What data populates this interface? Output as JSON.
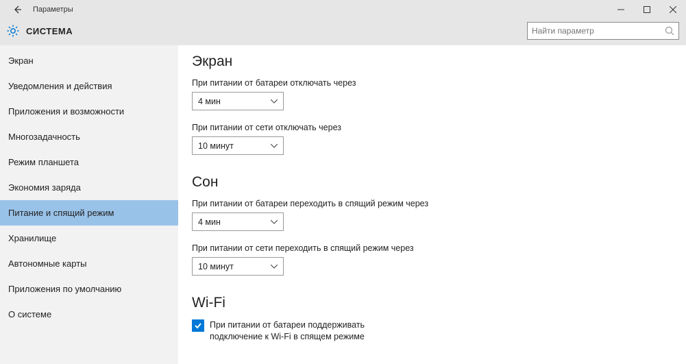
{
  "titlebar": {
    "title": "Параметры"
  },
  "header": {
    "section_name": "СИСТЕМА",
    "search_placeholder": "Найти параметр"
  },
  "sidebar": {
    "items": [
      "Экран",
      "Уведомления и действия",
      "Приложения и возможности",
      "Многозадачность",
      "Режим планшета",
      "Экономия заряда",
      "Питание и спящий режим",
      "Хранилище",
      "Автономные карты",
      "Приложения по умолчанию",
      "О системе"
    ],
    "selected_index": 6
  },
  "content": {
    "screen_heading": "Экран",
    "battery_off_label": "При питании от батареи отключать через",
    "battery_off_value": "4 мин",
    "ac_off_label": "При питании от сети отключать через",
    "ac_off_value": "10 минут",
    "sleep_heading": "Сон",
    "battery_sleep_label": "При питании от батареи переходить в спящий режим через",
    "battery_sleep_value": "4 мин",
    "ac_sleep_label": "При питании от сети переходить в спящий режим через",
    "ac_sleep_value": "10 минут",
    "wifi_heading": "Wi-Fi",
    "wifi_checkbox_label": "При питании от батареи поддерживать подключение к Wi-Fi в спящем режиме",
    "wifi_checked": true
  }
}
